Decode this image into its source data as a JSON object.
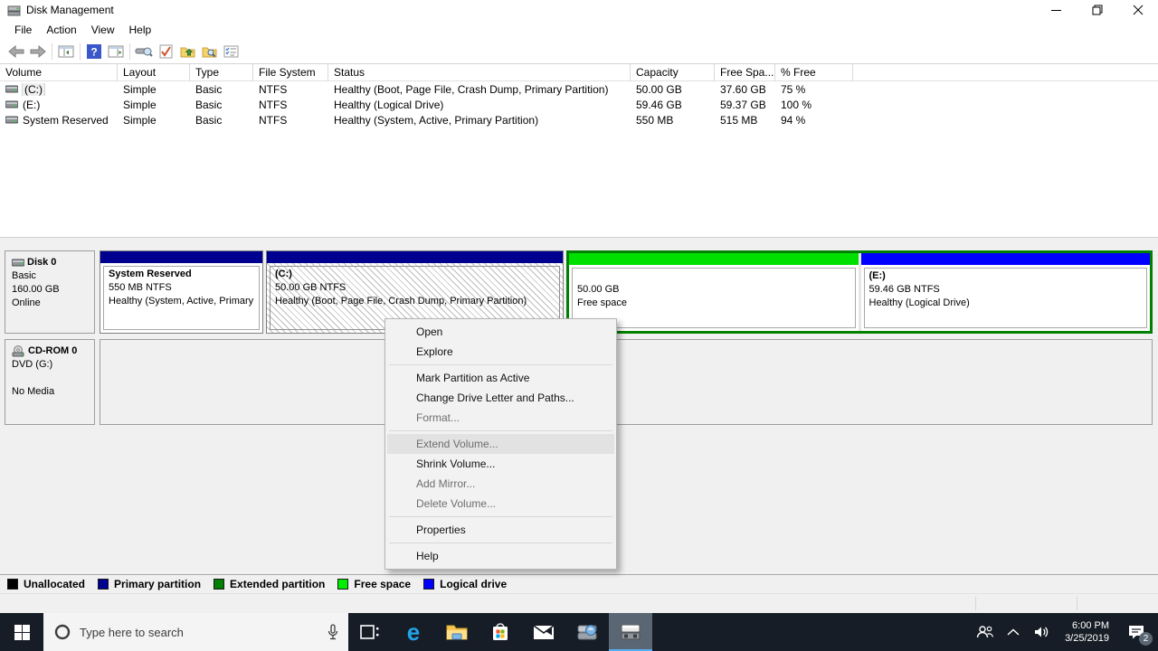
{
  "window": {
    "title": "Disk Management"
  },
  "menu_bar": {
    "items": [
      "File",
      "Action",
      "View",
      "Help"
    ]
  },
  "volume_table": {
    "columns": [
      "Volume",
      "Layout",
      "Type",
      "File System",
      "Status",
      "Capacity",
      "Free Spa...",
      "% Free"
    ],
    "rows": [
      {
        "volume": "(C:)",
        "layout": "Simple",
        "type": "Basic",
        "file_system": "NTFS",
        "status": "Healthy (Boot, Page File, Crash Dump, Primary Partition)",
        "capacity": "50.00 GB",
        "free_space": "37.60 GB",
        "pct_free": "75 %"
      },
      {
        "volume": "(E:)",
        "layout": "Simple",
        "type": "Basic",
        "file_system": "NTFS",
        "status": "Healthy (Logical Drive)",
        "capacity": "59.46 GB",
        "free_space": "59.37 GB",
        "pct_free": "100 %"
      },
      {
        "volume": "System Reserved",
        "layout": "Simple",
        "type": "Basic",
        "file_system": "NTFS",
        "status": "Healthy (System, Active, Primary Partition)",
        "capacity": "550 MB",
        "free_space": "515 MB",
        "pct_free": "94 %"
      }
    ]
  },
  "disks": [
    {
      "name": "Disk 0",
      "kind": "Basic",
      "size": "160.00 GB",
      "state": "Online",
      "partitions": [
        {
          "line1": "System Reserved",
          "line2": "550 MB NTFS",
          "line3": "Healthy (System, Active, Primary"
        },
        {
          "line1": "(C:)",
          "line2": "50.00 GB NTFS",
          "line3": "Healthy (Boot, Page File, Crash Dump, Primary Partition)"
        },
        {
          "line1": "",
          "line2": "50.00 GB",
          "line3": "Free space"
        },
        {
          "line1": "(E:)",
          "line2": "59.46 GB NTFS",
          "line3": "Healthy (Logical Drive)"
        }
      ]
    },
    {
      "name": "CD-ROM 0",
      "kind": "DVD (G:)",
      "state": "No Media"
    }
  ],
  "context_menu": {
    "items": [
      {
        "label": "Open"
      },
      {
        "label": "Explore"
      },
      {
        "label": "Mark Partition as Active"
      },
      {
        "label": "Change Drive Letter and Paths..."
      },
      {
        "label": "Format..."
      },
      {
        "label": "Extend Volume..."
      },
      {
        "label": "Shrink Volume..."
      },
      {
        "label": "Add Mirror..."
      },
      {
        "label": "Delete Volume..."
      },
      {
        "label": "Properties"
      },
      {
        "label": "Help"
      }
    ]
  },
  "legend": {
    "items": [
      {
        "label": "Unallocated",
        "color": "#000000"
      },
      {
        "label": "Primary partition",
        "color": "#000090"
      },
      {
        "label": "Extended partition",
        "color": "#008000"
      },
      {
        "label": "Free space",
        "color": "#00ee00"
      },
      {
        "label": "Logical drive",
        "color": "#0000ff"
      }
    ]
  },
  "taskbar": {
    "search_placeholder": "Type here to search",
    "clock": {
      "time": "6:00 PM",
      "date": "3/25/2019"
    },
    "notification_count": "2"
  },
  "colors": {
    "primary_partition": "#000090",
    "extended_partition": "#008000",
    "free_space": "#00e000",
    "logical_drive": "#0000ff",
    "taskbar_accent": "#55aef0"
  }
}
